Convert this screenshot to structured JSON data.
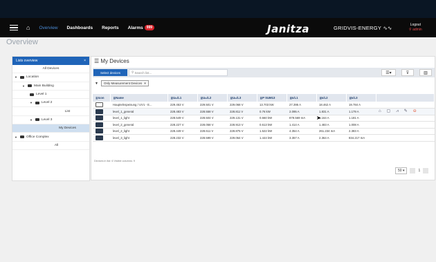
{
  "nav": {
    "items": [
      "Overview",
      "Dashboards",
      "Reports",
      "Alarms"
    ],
    "alarm_count": "999",
    "brand": "Janitza",
    "product": "GRIDVIS-ENERGY",
    "logout_label": "Logout",
    "user": "admin"
  },
  "page_title": "Overview",
  "lists": {
    "header": "Lists overview",
    "close": "×",
    "tree": [
      {
        "label": "All Devices",
        "level": 0,
        "folder": false,
        "caret": false
      },
      {
        "label": "Location",
        "level": 0,
        "folder": true,
        "caret": true
      },
      {
        "label": "Main Building",
        "level": 1,
        "folder": true,
        "caret": true
      },
      {
        "label": "Level 1",
        "level": 2,
        "folder": true,
        "caret": false
      },
      {
        "label": "Level 2",
        "level": 2,
        "folder": true,
        "caret": true
      },
      {
        "label": "List",
        "level": 3,
        "folder": false,
        "caret": false
      },
      {
        "label": "Level 3",
        "level": 2,
        "folder": true,
        "caret": true
      },
      {
        "label": "My Devices",
        "level": 3,
        "folder": false,
        "caret": false,
        "selected": true
      },
      {
        "label": "Office Complex",
        "level": 0,
        "folder": true,
        "caret": true
      },
      {
        "label": "All",
        "level": 1,
        "folder": false,
        "caret": false
      }
    ]
  },
  "devices": {
    "title": "My Devices",
    "select_label": "Select devices",
    "search_placeholder": "Search list...",
    "filter_chip": "Only Measurement Devices",
    "columns": [
      "Icon",
      "Name",
      "Uₗₙ/L1",
      "Uₗₙ/L2",
      "Uₗₙ/L3",
      "P SUM13",
      "Iₗ/L1",
      "Iₗ/L2",
      "Iₗ/L3"
    ],
    "rows": [
      {
        "icon": "meter-light",
        "name": "Hauptelnspeisung / UV1 - E...",
        "v": [
          "229.453 V",
          "229.501 V",
          "229.068 V",
          "13.703 kW",
          "27.395 A",
          "18.462 A",
          "19.784 A"
        ]
      },
      {
        "icon": "meter-dark",
        "name": "level_1_general",
        "v": [
          "228.483 V",
          "228.558 V",
          "228.811 V",
          "0.76 kW",
          "2.095 A",
          "1.831 A",
          "1.179 A"
        ],
        "highlight": true
      },
      {
        "icon": "meter-dark",
        "name": "level_1_light",
        "v": [
          "228.549 V",
          "228.504 V",
          "229.131 V",
          "0.660 kW",
          "879.569 mA",
          "1.164 A",
          "1.181 A"
        ]
      },
      {
        "icon": "meter-dark",
        "name": "level_2_general",
        "v": [
          "228.227 V",
          "228.058 V",
          "228.913 V",
          "0.613 kW",
          "1.414 A",
          "1.483 A",
          "1.008 A"
        ]
      },
      {
        "icon": "meter-dark",
        "name": "level_2_light",
        "v": [
          "228.449 V",
          "228.611 V",
          "228.875 V",
          "1.522 kW",
          "4.354 A",
          "261.234 mA",
          "2.383 A"
        ]
      },
      {
        "icon": "meter-dark",
        "name": "level_3_light",
        "v": [
          "228.232 V",
          "228.599 V",
          "229.064 V",
          "1.444 kW",
          "3.357 A",
          "2.364 A",
          "834.217 mA"
        ]
      }
    ],
    "footer": "Devices in list: 6     Visible columns: 9",
    "page_size": "50",
    "page": "1"
  }
}
